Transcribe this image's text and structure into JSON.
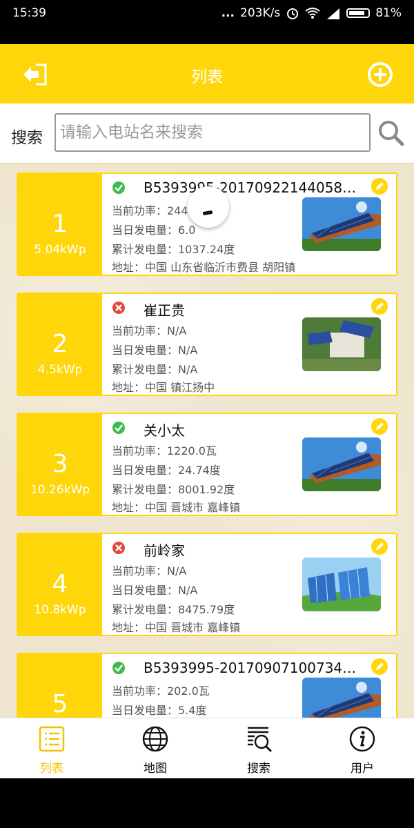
{
  "statusbar": {
    "time": "15:39",
    "network_speed": "203K/s",
    "battery": "81%",
    "dots": "...",
    "icons": [
      "alarm-icon",
      "wifi-icon",
      "signal-icon",
      "battery-icon"
    ]
  },
  "appbar": {
    "title": "列表",
    "back_icon": "back-exit-icon",
    "add_icon": "add-circle-icon"
  },
  "search": {
    "label": "搜索",
    "placeholder": "请输入电站名来搜索",
    "value": "",
    "button_icon": "search-icon"
  },
  "stations": [
    {
      "index": "1",
      "capacity": "5.04kWp",
      "status": "ok",
      "name": "B5393995-2017092214405863...",
      "power": "当前功率：244",
      "daily": "当日发电量：6.0",
      "total": "累计发电量：1037.24度",
      "address": "地址：中国 山东省临沂市费县 胡阳镇",
      "image": "solar-roof"
    },
    {
      "index": "2",
      "capacity": "4.5kWp",
      "status": "error",
      "name": "崔正贵",
      "power": "当前功率：N/A",
      "daily": "当日发电量：N/A",
      "total": "累计发电量：N/A",
      "address": "地址：中国 镇江扬中",
      "image": "aerial-house"
    },
    {
      "index": "3",
      "capacity": "10.26kWp",
      "status": "ok",
      "name": "关小太",
      "power": "当前功率：1220.0瓦",
      "daily": "当日发电量：24.74度",
      "total": "累计发电量：8001.92度",
      "address": "地址：中国 晋城市 嘉峰镇",
      "image": "solar-roof"
    },
    {
      "index": "4",
      "capacity": "10.8kWp",
      "status": "error",
      "name": "前岭家",
      "power": "当前功率：N/A",
      "daily": "当日发电量：N/A",
      "total": "累计发电量：8475.79度",
      "address": "地址：中国 晋城市 嘉峰镇",
      "image": "solar-field"
    },
    {
      "index": "5",
      "capacity": "",
      "status": "ok",
      "name": "B5393995-2017090710073477...",
      "power": "当前功率：202.0瓦",
      "daily": "当日发电量：5.4度",
      "total": "",
      "address": "",
      "image": "solar-roof"
    }
  ],
  "tabs": [
    {
      "label": "列表",
      "icon": "list-icon",
      "active": true
    },
    {
      "label": "地图",
      "icon": "globe-icon",
      "active": false
    },
    {
      "label": "搜索",
      "icon": "search-doc-icon",
      "active": false
    },
    {
      "label": "用户",
      "icon": "info-icon",
      "active": false
    }
  ],
  "colors": {
    "accent": "#FFD60A",
    "ok": "#3DBA4E",
    "error": "#E2473F",
    "active_tab": "#F2C200"
  }
}
